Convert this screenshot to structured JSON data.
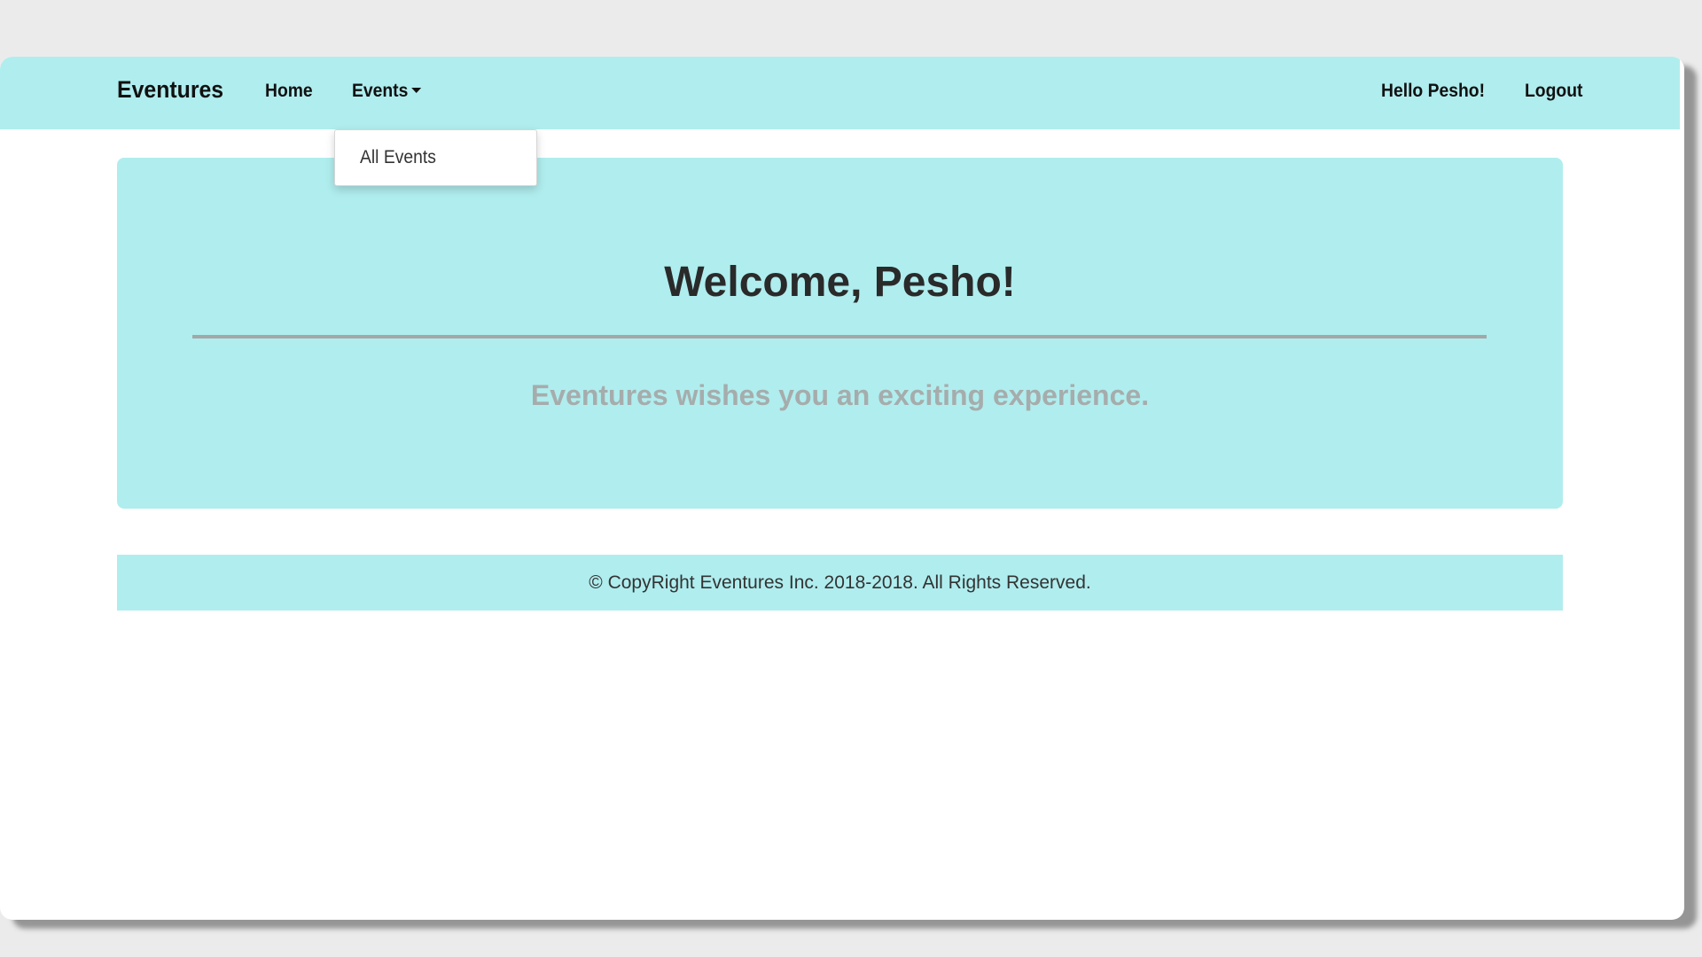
{
  "navbar": {
    "brand": "Eventures",
    "home_label": "Home",
    "events_label": "Events",
    "greeting": "Hello Pesho!",
    "logout_label": "Logout"
  },
  "events_dropdown": {
    "items": [
      {
        "label": "All Events"
      }
    ]
  },
  "jumbotron": {
    "title": "Welcome, Pesho!",
    "tagline": "Eventures wishes you an exciting experience."
  },
  "footer": {
    "text": "© CopyRight Eventures Inc. 2018-2018. All Rights Reserved."
  },
  "colors": {
    "accent": "#b0edee",
    "page_background": "#ebebeb",
    "title_text": "#2a2a2a",
    "tagline_text": "#a6acac"
  },
  "icons": {
    "events_toggle": "caret-down-icon"
  }
}
